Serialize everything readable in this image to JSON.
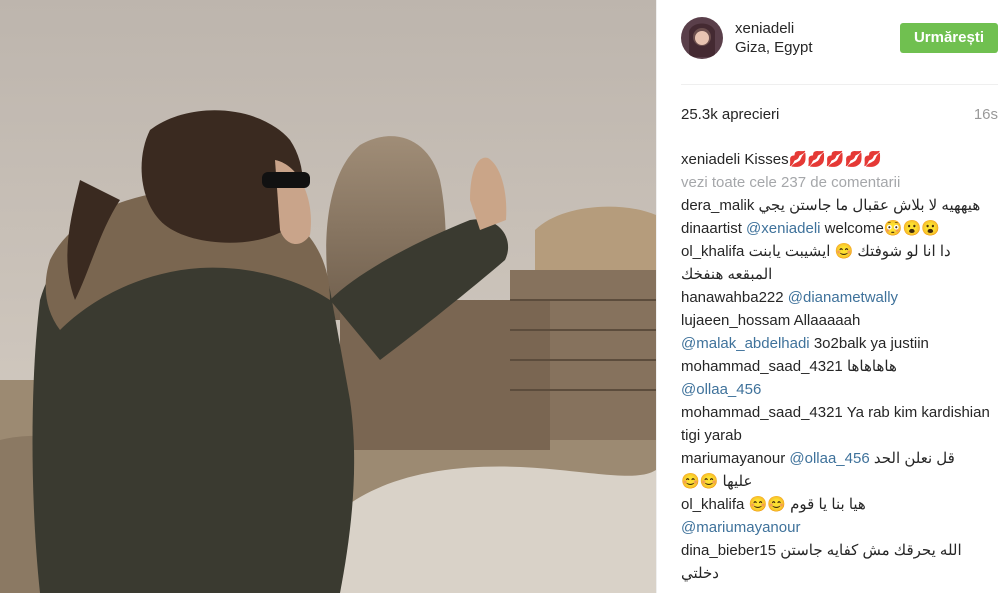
{
  "post": {
    "username": "xeniadeli",
    "location": "Giza, Egypt",
    "follow_label": "Urmărești",
    "likes": "25.3k aprecieri",
    "time": "16s",
    "caption_text": "Kisses💋💋💋💋💋",
    "view_all": "vezi toate cele 237 de comentarii"
  },
  "comments": [
    {
      "user": "dera_malik",
      "text": "هيههيه لا بلاش عقبال ما جاستن يجي"
    },
    {
      "user": "dinaartist",
      "mention": "@xeniadeli",
      "text": " welcome😳😮😮"
    },
    {
      "user": "ol_khalifa",
      "text": "دا انا لو شوفتك 😊 ايشيبت يابنت المبقعه هنفخك"
    },
    {
      "user": "hanawahba222",
      "mention": "@dianametwally",
      "text": ""
    },
    {
      "user": "lujaeen_hossam",
      "text": "Allaaaaah",
      "mention2": "@malak_abdelhadi",
      "text2": " 3o2balk ya justiin"
    },
    {
      "user": "mohammad_saad_4321",
      "text": "هاهاهاها",
      "mention2": "@ollaa_456",
      "text2": ""
    },
    {
      "user": "mohammad_saad_4321",
      "text": "Ya rab kim kardishian tigi yarab"
    },
    {
      "user": "mariumayanour",
      "mention": "@ollaa_456",
      "text": " قل نعلن الحد",
      "text2": "😊😊 عليها"
    },
    {
      "user": "ol_khalifa",
      "text": "😊😊 هيا بنا يا قوم",
      "mention2": "@mariumayanour",
      "text2": ""
    },
    {
      "user": "dina_bieber15",
      "text": "الله يحرقك مش كفايه جاستن دخلتي"
    }
  ],
  "colors": {
    "follow": "#70c050",
    "mention": "#3f729b",
    "muted": "#a5a7aa"
  }
}
